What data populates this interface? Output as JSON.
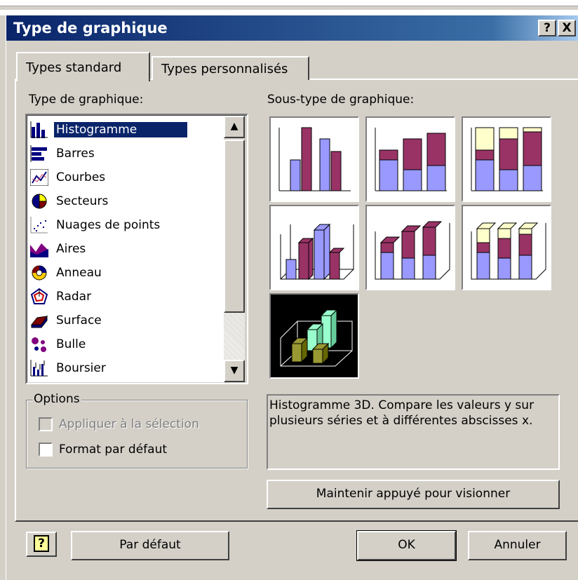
{
  "window": {
    "title": "Type de graphique",
    "help_btn": "?",
    "close_btn": "X"
  },
  "tabs": [
    {
      "label": "Types standard",
      "active": true
    },
    {
      "label": "Types personnalisés",
      "active": false
    }
  ],
  "left": {
    "label": "Type de graphique:",
    "items": [
      {
        "label": "Histogramme",
        "icon": "column-chart-icon",
        "selected": true
      },
      {
        "label": "Barres",
        "icon": "bar-chart-icon"
      },
      {
        "label": "Courbes",
        "icon": "line-chart-icon"
      },
      {
        "label": "Secteurs",
        "icon": "pie-chart-icon"
      },
      {
        "label": "Nuages de points",
        "icon": "scatter-chart-icon"
      },
      {
        "label": "Aires",
        "icon": "area-chart-icon"
      },
      {
        "label": "Anneau",
        "icon": "doughnut-chart-icon"
      },
      {
        "label": "Radar",
        "icon": "radar-chart-icon"
      },
      {
        "label": "Surface",
        "icon": "surface-chart-icon"
      },
      {
        "label": "Bulle",
        "icon": "bubble-chart-icon"
      },
      {
        "label": "Boursier",
        "icon": "stock-chart-icon"
      }
    ]
  },
  "options": {
    "legend": "Options",
    "apply_selection": "Appliquer à la sélection",
    "default_format": "Format par défaut"
  },
  "right": {
    "label": "Sous-type de graphique:",
    "description": "Histogramme 3D. Compare les valeurs y sur plusieurs séries et à différentes abscisses x.",
    "preview_button": "Maintenir appuyé pour visionner"
  },
  "footer": {
    "help": "?",
    "default": "Par défaut",
    "ok": "OK",
    "cancel": "Annuler"
  },
  "colors": {
    "title_start": "#0a246a",
    "title_end": "#a6caf0",
    "selection": "#0a246a",
    "series1": "#9999ff",
    "series2": "#993366",
    "series3": "#ffffcc",
    "series3d_a": "#999933",
    "series3d_b": "#99ffcc"
  }
}
